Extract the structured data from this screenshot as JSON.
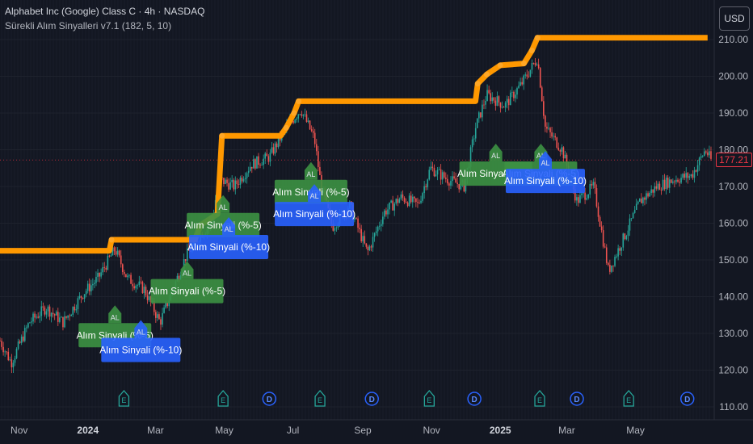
{
  "header": {
    "symbol": "Alphabet Inc (Google) Class C · 4h · NASDAQ",
    "indicator": "Sürekli Alım Sinyalleri v7.1 (182, 5, 10)"
  },
  "currency_button": "USD",
  "last_price": "177.21",
  "colors": {
    "background": "#131722",
    "up": "#26a69a",
    "down": "#ef5350",
    "trail": "#ff9800",
    "signal5": "#3d9142",
    "signal10": "#2962ff",
    "grid": "#1e222d"
  },
  "chart_data": {
    "type": "line",
    "ylim": [
      110,
      215
    ],
    "yticks": [
      "110.00",
      "120.00",
      "130.00",
      "140.00",
      "150.00",
      "160.00",
      "170.00",
      "180.00",
      "190.00",
      "200.00",
      "210.00"
    ],
    "xticks": [
      "Nov",
      "2024",
      "Mar",
      "May",
      "Jul",
      "Sep",
      "Nov",
      "2025",
      "Mar",
      "May"
    ],
    "series": [
      {
        "type": "step",
        "values": [
          {
            "x": "2023-10-15",
            "y": 152.5
          },
          {
            "x": "2024-01-20",
            "y": 152.5
          },
          {
            "x": "2024-01-22",
            "y": 155.5
          },
          {
            "x": "2024-04-05",
            "y": 155.5
          },
          {
            "x": "2024-04-10",
            "y": 159.5
          },
          {
            "x": "2024-04-20",
            "y": 161.5
          },
          {
            "x": "2024-04-25",
            "y": 162.5
          },
          {
            "x": "2024-04-29",
            "y": 183.8
          },
          {
            "x": "2024-06-20",
            "y": 183.8
          },
          {
            "x": "2024-06-25",
            "y": 186
          },
          {
            "x": "2024-07-02",
            "y": 190
          },
          {
            "x": "2024-07-06",
            "y": 193.2
          },
          {
            "x": "2024-12-10",
            "y": 193.2
          },
          {
            "x": "2024-12-12",
            "y": 198
          },
          {
            "x": "2024-12-20",
            "y": 200.5
          },
          {
            "x": "2025-01-01",
            "y": 203
          },
          {
            "x": "2025-01-22",
            "y": 203.5
          },
          {
            "x": "2025-01-29",
            "y": 207
          },
          {
            "x": "2025-02-03",
            "y": 210.5
          },
          {
            "x": "2025-06-30",
            "y": 210.5
          },
          {
            "x": "2025-07-04",
            "y": 210.5
          }
        ]
      },
      {
        "type": "candles",
        "values": [
          {
            "x": "2023-10-15",
            "y": 128
          },
          {
            "x": "2023-10-25",
            "y": 122
          },
          {
            "x": "2023-11-10",
            "y": 133
          },
          {
            "x": "2023-11-25",
            "y": 137
          },
          {
            "x": "2023-12-10",
            "y": 133
          },
          {
            "x": "2023-12-28",
            "y": 141
          },
          {
            "x": "2024-01-10",
            "y": 145
          },
          {
            "x": "2024-01-25",
            "y": 153
          },
          {
            "x": "2024-02-05",
            "y": 145
          },
          {
            "x": "2024-02-20",
            "y": 142
          },
          {
            "x": "2024-03-05",
            "y": 133
          },
          {
            "x": "2024-03-15",
            "y": 141
          },
          {
            "x": "2024-03-28",
            "y": 151
          },
          {
            "x": "2024-04-10",
            "y": 157
          },
          {
            "x": "2024-04-20",
            "y": 160
          },
          {
            "x": "2024-04-26",
            "y": 172
          },
          {
            "x": "2024-05-10",
            "y": 170
          },
          {
            "x": "2024-05-25",
            "y": 176
          },
          {
            "x": "2024-06-10",
            "y": 178
          },
          {
            "x": "2024-06-25",
            "y": 186
          },
          {
            "x": "2024-07-08",
            "y": 191
          },
          {
            "x": "2024-07-20",
            "y": 183
          },
          {
            "x": "2024-07-26",
            "y": 170
          },
          {
            "x": "2024-08-05",
            "y": 159
          },
          {
            "x": "2024-08-20",
            "y": 165
          },
          {
            "x": "2024-09-05",
            "y": 152
          },
          {
            "x": "2024-09-20",
            "y": 163
          },
          {
            "x": "2024-10-05",
            "y": 167
          },
          {
            "x": "2024-10-20",
            "y": 165
          },
          {
            "x": "2024-10-31",
            "y": 175
          },
          {
            "x": "2024-11-15",
            "y": 172
          },
          {
            "x": "2024-11-30",
            "y": 170
          },
          {
            "x": "2024-12-10",
            "y": 186
          },
          {
            "x": "2024-12-20",
            "y": 195
          },
          {
            "x": "2025-01-05",
            "y": 192
          },
          {
            "x": "2025-01-20",
            "y": 198
          },
          {
            "x": "2025-02-03",
            "y": 205
          },
          {
            "x": "2025-02-10",
            "y": 186
          },
          {
            "x": "2025-02-25",
            "y": 180
          },
          {
            "x": "2025-03-10",
            "y": 166
          },
          {
            "x": "2025-03-25",
            "y": 170
          },
          {
            "x": "2025-04-07",
            "y": 147
          },
          {
            "x": "2025-04-22",
            "y": 157
          },
          {
            "x": "2025-05-05",
            "y": 166
          },
          {
            "x": "2025-05-20",
            "y": 170
          },
          {
            "x": "2025-06-05",
            "y": 172
          },
          {
            "x": "2025-06-20",
            "y": 173
          },
          {
            "x": "2025-07-02",
            "y": 180
          },
          {
            "x": "2025-07-07",
            "y": 177.21
          }
        ]
      }
    ],
    "signals": [
      {
        "x": "2024-01-25",
        "y": 135,
        "text": "Alım Sinyali (%-5)",
        "kind": "5"
      },
      {
        "x": "2024-02-17",
        "y": 131,
        "text": "Alım Sinyali (%-10)",
        "kind": "10"
      },
      {
        "x": "2024-03-29",
        "y": 147,
        "text": "Alım Sinyali (%-5)",
        "kind": "5"
      },
      {
        "x": "2024-04-30",
        "y": 165,
        "text": "Alım Sinyali (%-5)",
        "kind": "5"
      },
      {
        "x": "2024-05-05",
        "y": 159,
        "text": "Alım Sinyali (%-10)",
        "kind": "10"
      },
      {
        "x": "2024-07-17",
        "y": 174,
        "text": "Alım Sinyali (%-5)",
        "kind": "5"
      },
      {
        "x": "2024-07-20",
        "y": 168,
        "text": "Alım Sinyali (%-10)",
        "kind": "10"
      },
      {
        "x": "2024-12-28",
        "y": 179,
        "text": "Alım Sinyali (%-5)",
        "kind": "5"
      },
      {
        "x": "2025-02-06",
        "y": 179,
        "text": "Alım Sinyali (%-5)",
        "kind": "5"
      },
      {
        "x": "2025-02-10",
        "y": 177,
        "text": "Alım Sinyali (%-10)",
        "kind": "10"
      }
    ],
    "events": [
      {
        "x": "2024-02-02",
        "type": "E"
      },
      {
        "x": "2024-04-30",
        "type": "E"
      },
      {
        "x": "2024-06-10",
        "type": "D"
      },
      {
        "x": "2024-07-25",
        "type": "E"
      },
      {
        "x": "2024-09-09",
        "type": "D"
      },
      {
        "x": "2024-10-30",
        "type": "E"
      },
      {
        "x": "2024-12-09",
        "type": "D"
      },
      {
        "x": "2025-02-05",
        "type": "E"
      },
      {
        "x": "2025-03-10",
        "type": "D"
      },
      {
        "x": "2025-04-25",
        "type": "E"
      },
      {
        "x": "2025-06-16",
        "type": "D"
      }
    ]
  }
}
